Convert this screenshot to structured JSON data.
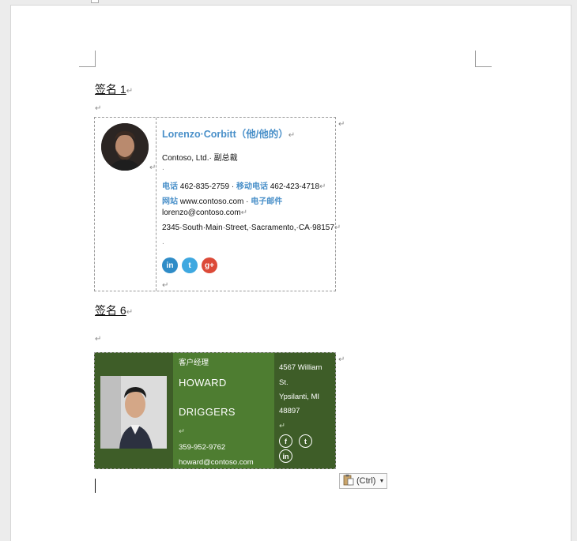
{
  "document": {
    "paragraph_mark": "↵",
    "cell_mark": "↵"
  },
  "signature1": {
    "heading": "签名 1",
    "name": "Lorenzo·Corbitt（他/他的）",
    "company": "Contoso, Ltd.· 副总裁",
    "phone_label": "电话",
    "phone": "462-835-2759 ·",
    "mobile_label": "移动电话",
    "mobile": "462-423-4718",
    "website_label": "网站",
    "website": "www.contoso.com ·",
    "email_label": "电子邮件",
    "email": "lorenzo@contoso.com",
    "address": "2345·South·Main·Street,·Sacramento,·CA·98157",
    "social": [
      "in",
      "t",
      "g+"
    ]
  },
  "signature6": {
    "heading": "签名 6",
    "title": "客户经理",
    "first_name": "HOWARD",
    "last_name": "DRIGGERS",
    "phone": "359-952-9762",
    "email": "howard@contoso.com",
    "address_line1": "4567 William",
    "address_line2": "St.",
    "address_line3": "Ypsilanti, MI",
    "address_line4": "48897",
    "social": [
      "f",
      "t",
      "in"
    ]
  },
  "paste_options": {
    "label": "(Ctrl)",
    "icon": "clipboard-icon"
  },
  "colors": {
    "accent_blue": "#4a90c9",
    "sig6_dark_green": "#3e5d28",
    "sig6_mid_green": "#4e7d31",
    "linkedin": "#2f8cc7",
    "twitter": "#3fa8e0",
    "googleplus": "#dc4a38"
  }
}
